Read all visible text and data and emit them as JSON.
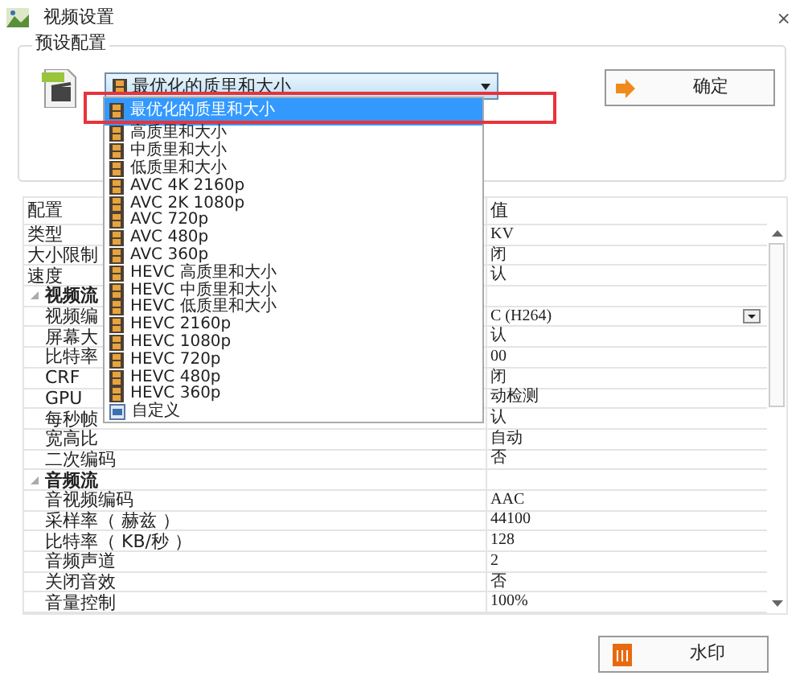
{
  "window": {
    "title": "视频设置",
    "close": "×"
  },
  "preset": {
    "legend": "预设配置",
    "combo": {
      "value": "最优化的质里和大小",
      "expanded": true
    },
    "options": [
      {
        "label": "最优化的质里和大小",
        "kind": "film",
        "selected": true
      },
      {
        "label": "高质里和大小",
        "kind": "film",
        "selected": false
      },
      {
        "label": "中质里和大小",
        "kind": "film",
        "selected": false
      },
      {
        "label": "低质里和大小",
        "kind": "film",
        "selected": false
      },
      {
        "label": "AVC 4K 2160p",
        "kind": "film",
        "selected": false
      },
      {
        "label": "AVC 2K 1080p",
        "kind": "film",
        "selected": false
      },
      {
        "label": "AVC 720p",
        "kind": "film",
        "selected": false
      },
      {
        "label": "AVC 480p",
        "kind": "film",
        "selected": false
      },
      {
        "label": "AVC 360p",
        "kind": "film",
        "selected": false
      },
      {
        "label": "HEVC 高质里和大小",
        "kind": "film",
        "selected": false
      },
      {
        "label": "HEVC 中质里和大小",
        "kind": "film",
        "selected": false
      },
      {
        "label": "HEVC 低质里和大小",
        "kind": "film",
        "selected": false
      },
      {
        "label": "HEVC 2160p",
        "kind": "film",
        "selected": false
      },
      {
        "label": "HEVC 1080p",
        "kind": "film",
        "selected": false
      },
      {
        "label": "HEVC 720p",
        "kind": "film",
        "selected": false
      },
      {
        "label": "HEVC 480p",
        "kind": "film",
        "selected": false
      },
      {
        "label": "HEVC 360p",
        "kind": "film",
        "selected": false
      },
      {
        "label": "自定义",
        "kind": "custom",
        "selected": false
      }
    ],
    "ok_button": "确定"
  },
  "table": {
    "columns": [
      "配置",
      "值"
    ],
    "rows": [
      {
        "label": "类型",
        "value": "KV",
        "kind": "setting"
      },
      {
        "label": "大小限制",
        "value": "闭",
        "kind": "setting"
      },
      {
        "label": "速度",
        "value": "认",
        "kind": "setting"
      },
      {
        "label": "视频流",
        "kind": "group",
        "expanded": true
      },
      {
        "label": "视频编",
        "value": "C (H264)",
        "kind": "select"
      },
      {
        "label": "屏幕大",
        "value": "认",
        "kind": "child"
      },
      {
        "label": "比特率",
        "value": "00",
        "kind": "child"
      },
      {
        "label": "CRF",
        "value": "闭",
        "kind": "child"
      },
      {
        "label": "GPU",
        "value": "动检测",
        "kind": "child"
      },
      {
        "label": "每秒帧",
        "value": "认",
        "kind": "child"
      },
      {
        "label": "宽高比",
        "value": "自动",
        "kind": "child"
      },
      {
        "label": "二次编码",
        "value": "否",
        "kind": "child"
      },
      {
        "label": "音频流",
        "kind": "group",
        "expanded": true
      },
      {
        "label": "音视频编码",
        "value": "AAC",
        "kind": "child"
      },
      {
        "label": "采样率（ 赫兹 ）",
        "value": "44100",
        "kind": "child"
      },
      {
        "label": "比特率（ KB/秒 ）",
        "value": "128",
        "kind": "child"
      },
      {
        "label": "音频声道",
        "value": "2",
        "kind": "child"
      },
      {
        "label": "关闭音效",
        "value": "否",
        "kind": "child"
      },
      {
        "label": "音量控制",
        "value": "100%",
        "kind": "child"
      }
    ]
  },
  "watermark_button": "水印"
}
